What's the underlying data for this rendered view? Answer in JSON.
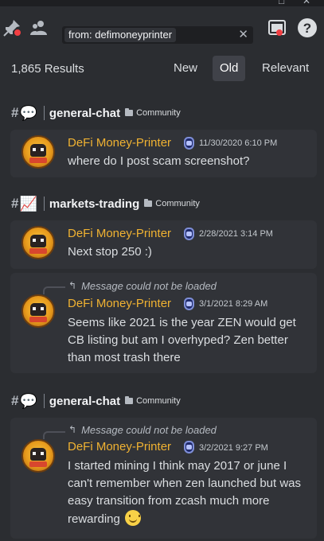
{
  "window": {
    "maximize_glyph": "□",
    "close_glyph": "✕"
  },
  "header": {
    "icons": [
      "pin-icon",
      "members-icon",
      "inbox-icon",
      "help-icon"
    ],
    "search": {
      "chip_text": "from: defimoneyprinter",
      "clear_glyph": "✕"
    },
    "help_glyph": "?"
  },
  "results": {
    "count_label": "1,865 Results",
    "sort_options": [
      "New",
      "Old",
      "Relevant"
    ],
    "active_sort": "Old"
  },
  "groups": [
    {
      "hash": "#",
      "channel_emoji": "💬",
      "channel": "general-chat",
      "category": "Community",
      "messages": [
        {
          "author": "DeFi Money-Printer",
          "timestamp": "11/30/2020 6:10 PM",
          "text": "where do I post scam screenshot?"
        }
      ]
    },
    {
      "hash": "#",
      "channel_emoji": "📈",
      "channel": "markets-trading",
      "category": "Community",
      "messages": [
        {
          "author": "DeFi Money-Printer",
          "timestamp": "2/28/2021 3:14 PM",
          "text": "Next stop 250 :)"
        },
        {
          "reply": "Message could not be loaded",
          "author": "DeFi Money-Printer",
          "timestamp": "3/1/2021 8:29 AM",
          "text": "Seems like 2021 is the year ZEN would get CB listing but am I overhyped? Zen better than most trash there"
        }
      ]
    },
    {
      "hash": "#",
      "channel_emoji": "💬",
      "channel": "general-chat",
      "category": "Community",
      "messages": [
        {
          "reply": "Message could not be loaded",
          "author": "DeFi Money-Printer",
          "timestamp": "3/2/2021 9:27 PM",
          "text": "I started mining I think may 2017 or june I can't remember when zen launched but was easy transition from zcash much more rewarding"
        }
      ]
    }
  ],
  "colors": {
    "username": "#f0b232",
    "background": "#2b2d31",
    "card": "#313338",
    "active_sort": "#404249"
  }
}
